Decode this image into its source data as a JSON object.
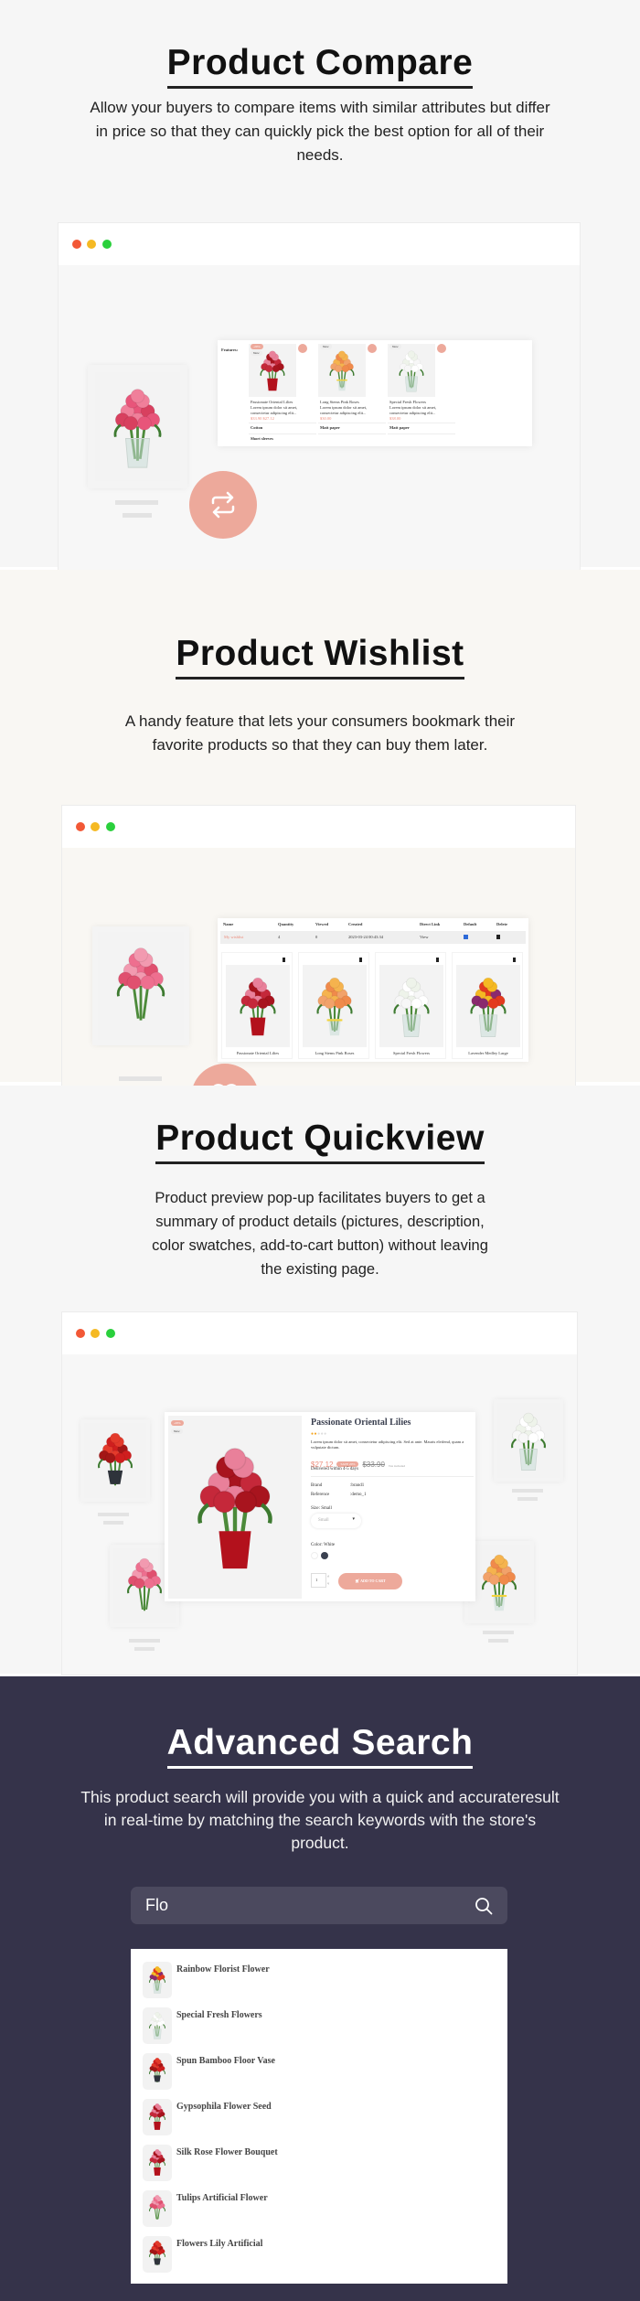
{
  "colors": {
    "accent": "#eda99b",
    "price": "#ec8b7b",
    "dot_red": "#f25836",
    "dot_yellow": "#f5b923",
    "dot_green": "#2ad03c",
    "dark_bg": "#35334a"
  },
  "compare": {
    "title": "Product Compare",
    "description": "Allow your buyers to compare items with similar attributes but differ in price so that they can quickly pick the best option for all of their needs.",
    "features_label": "Features:",
    "badge_sale": "-20%",
    "badge_new": "New",
    "products": [
      {
        "name": "Passionate Oriental Lilies",
        "desc": "Lorem ipsum dolor sit amet, consectetur adipiscing elit...",
        "price": "$33.90 $27.12",
        "row1": "Cotton",
        "row2": "Short sleeves"
      },
      {
        "name": "Long Stems Pink Roses",
        "desc": "Lorem ipsum dolor sit amet, consectetur adipiscing elit...",
        "price": "$30.00",
        "row1": "Matt paper",
        "row2": ""
      },
      {
        "name": "Special Fresh Flowers",
        "desc": "Lorem ipsum dolor sit amet, consectetur adipiscing elit...",
        "price": "$38.00",
        "row1": "Matt paper",
        "row2": ""
      }
    ],
    "icon": "swap-arrows-icon"
  },
  "wishlist": {
    "title": "Product Wishlist",
    "description": "A handy feature that lets your consumers bookmark their favorite products so that they can buy them later.",
    "headers": [
      "Name",
      "Quantity",
      "Viewed",
      "Created",
      "Direct Link",
      "Default",
      "Delete"
    ],
    "row": {
      "name": "My wishlist",
      "quantity": "4",
      "viewed": "0",
      "created": "2023-03-24 00:43:34",
      "link": "View"
    },
    "products": [
      "Passionate Oriental Lilies",
      "Long Stems Pink Roses",
      "Special Fresh Flowers",
      "Lavender Medley Large"
    ],
    "icon": "heart-icon"
  },
  "quickview": {
    "title": "Product Quickview",
    "description": "Product preview pop-up facilitates buyers to get a summary of product details (pictures, description, color swatches, add-to-cart button) without leaving the existing page.",
    "product": {
      "badge_sale": "-20%",
      "badge_new": "New",
      "name": "Passionate Oriental Lilies",
      "rating": 2,
      "rating_max": 5,
      "desc": "Lorem ipsum dolor sit amet, consectetur adipiscing elit. Sed at ante. Mauris eleifend, quam a vulputate dictum.",
      "price": "$27.12",
      "save": "SAVE 20%",
      "old_price": "$33.90",
      "tax": "Tax included",
      "delivery": "Delivered within 4-5 days",
      "brand_label": "Brand",
      "brand": ":brand1",
      "ref_label": "Reference",
      "ref": ":demo_1",
      "size_label": "Size: Small",
      "size_value": "Small",
      "color_label": "Color: White",
      "qty": "1",
      "add_to_cart": "ADD TO CART"
    }
  },
  "search": {
    "title": "Advanced Search",
    "description": "This product search will provide you with a quick and accurateresult in real-time by matching the search keywords with the store's product.",
    "query": "Flo",
    "results": [
      "Rainbow Florist Flower",
      "Special Fresh Flowers",
      "Spun Bamboo Floor Vase",
      "Gypsophila Flower Seed",
      "Silk Rose Flower Bouquet",
      "Tulips Artificial Flower",
      "Flowers Lily Artificial"
    ]
  }
}
